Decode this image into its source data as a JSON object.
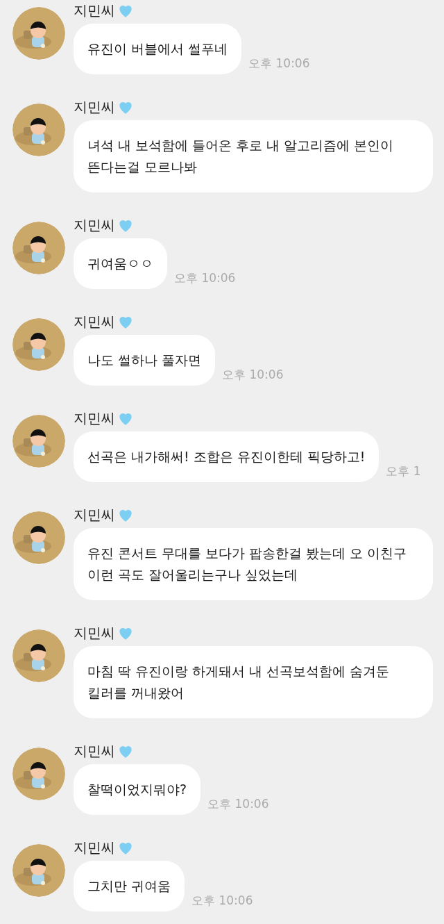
{
  "messages": [
    {
      "sender": "지민씨",
      "text": "유진이 버블에서 썰푸네",
      "time": "오후 10:06"
    },
    {
      "sender": "지민씨",
      "text": "녀석 내 보석함에 들어온 후로 내 알고리즘에 본인이 뜬다는걸 모르나봐"
    },
    {
      "sender": "지민씨",
      "text": "귀여움ㅇㅇ",
      "time": "오후 10:06"
    },
    {
      "sender": "지민씨",
      "text": "나도 썰하나 풀자면",
      "time": "오후 10:06"
    },
    {
      "sender": "지민씨",
      "text": "선곡은 내가해써! 조합은 유진이한테 픽당하고!",
      "time": "오후 1"
    },
    {
      "sender": "지민씨",
      "text": "유진 콘서트 무대를 보다가 팝송한걸 봤는데 오 이친구 이런 곡도 잘어울리는구나 싶었는데"
    },
    {
      "sender": "지민씨",
      "text": "마침 딱 유진이랑 하게돼서 내 선곡보석함에 숨겨둔 킬러를 꺼내왔어"
    },
    {
      "sender": "지민씨",
      "text": "찰떡이었지뭐야?",
      "time": "오후 10:06"
    },
    {
      "sender": "지민씨",
      "text": "그치만 귀여움",
      "time": "오후 10:06"
    }
  ]
}
